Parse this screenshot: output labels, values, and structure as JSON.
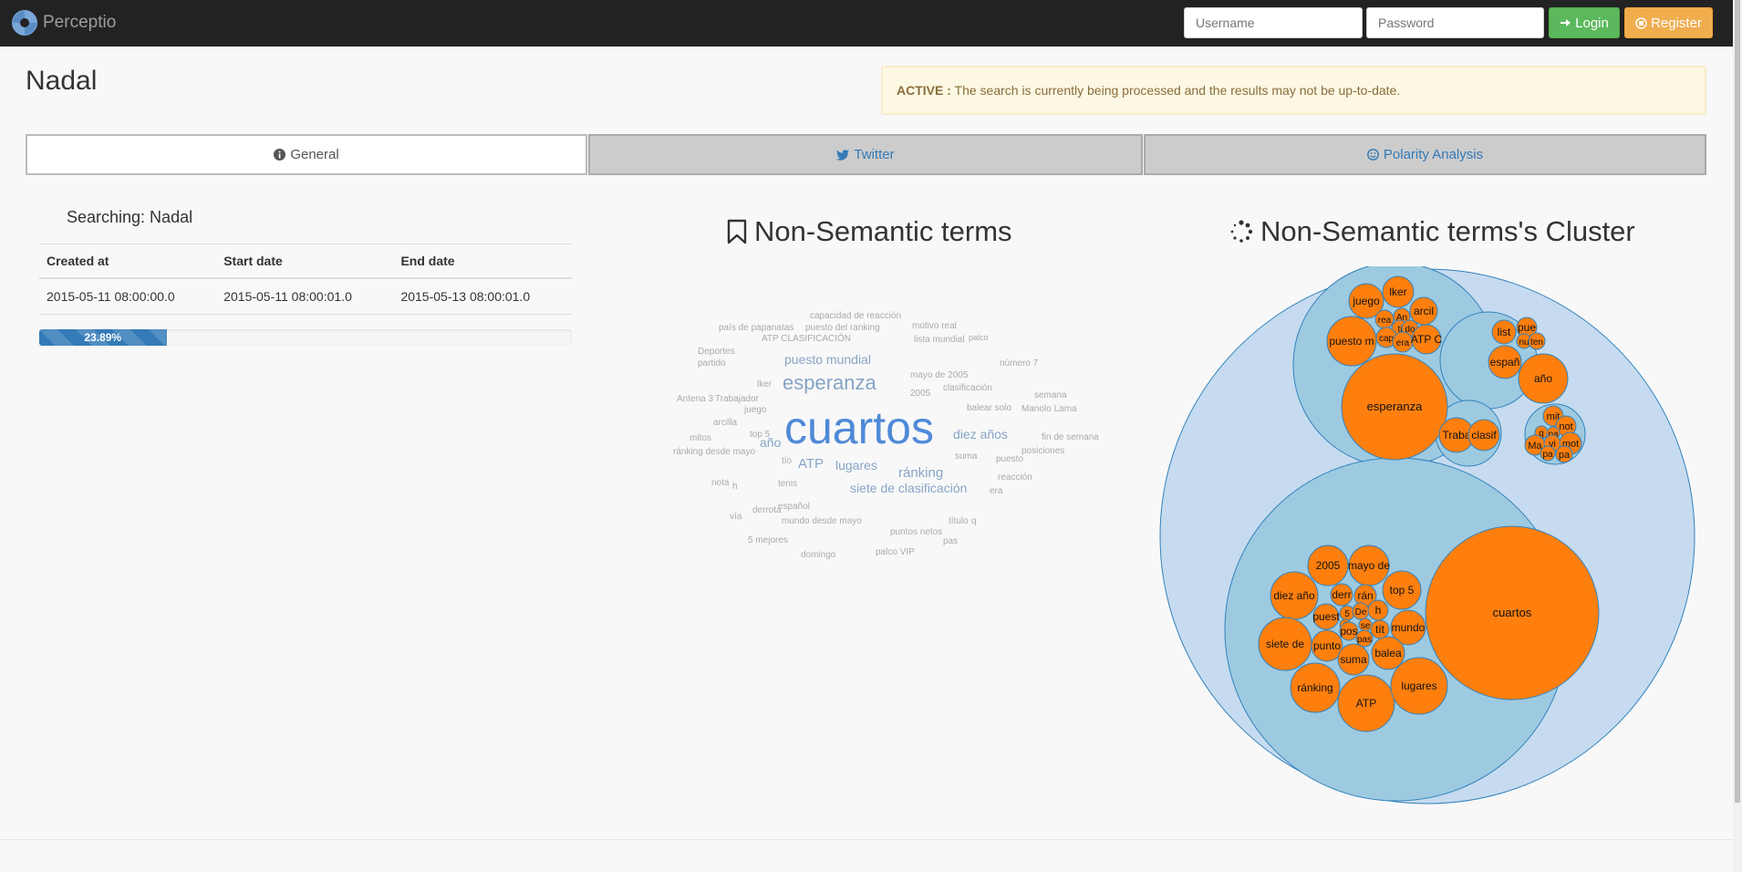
{
  "navbar": {
    "brand": "Perceptio",
    "username_placeholder": "Username",
    "password_placeholder": "Password",
    "login_label": "Login",
    "register_label": "Register"
  },
  "page": {
    "title": "Nadal",
    "alert_strong": "ACTIVE :",
    "alert_text": " The search is currently being processed and the results may not be up-to-date."
  },
  "tabs": [
    {
      "label": "General",
      "icon": "info-circle-icon"
    },
    {
      "label": "Twitter",
      "icon": "twitter-icon"
    },
    {
      "label": "Polarity Analysis",
      "icon": "smile-icon"
    }
  ],
  "general": {
    "searching": "Searching: Nadal",
    "headers": [
      "Created at",
      "Start date",
      "End date"
    ],
    "row": [
      "2015-05-11 08:00:00.0",
      "2015-05-11 08:00:01.0",
      "2015-05-13 08:00:01.0"
    ],
    "progress": 23.89,
    "progress_label": "23.89%"
  },
  "sections": {
    "wordcloud_title": "Non-Semantic terms",
    "cluster_title": "Non-Semantic terms's Cluster"
  },
  "colors": {
    "accent": "#337ab7",
    "bubble": "#ff7f0e",
    "cluster_outer": "#c6dbef",
    "cluster_inner": "#9ecae1"
  },
  "wordcloud": [
    {
      "text": "cuartos",
      "size": 50,
      "color": "#4f8ad8"
    },
    {
      "text": "esperanza",
      "size": 22,
      "color": "#86a4c6"
    },
    {
      "text": "puesto mundial",
      "size": 14,
      "color": "#86a4c6"
    },
    {
      "text": "diez años",
      "size": 14,
      "color": "#86a4c6"
    },
    {
      "text": "ránking",
      "size": 15,
      "color": "#86a4c6"
    },
    {
      "text": "siete de clasificación",
      "size": 14,
      "color": "#86a4c6"
    },
    {
      "text": "lugares",
      "size": 14,
      "color": "#86a4c6"
    },
    {
      "text": "ATP",
      "size": 15,
      "color": "#86a4c6"
    },
    {
      "text": "año",
      "size": 14,
      "color": "#86a4c6"
    },
    {
      "text": "capacidad de reacción",
      "size": 10,
      "color": "#aaaaaa"
    },
    {
      "text": "país de papanatas",
      "size": 10,
      "color": "#aaaaaa"
    },
    {
      "text": "puesto del ranking",
      "size": 10,
      "color": "#aaaaaa"
    },
    {
      "text": "motivo real",
      "size": 10,
      "color": "#aaaaaa"
    },
    {
      "text": "ATP CLASIFICACIÓN",
      "size": 10,
      "color": "#aaaaaa"
    },
    {
      "text": "lista mundial",
      "size": 10,
      "color": "#aaaaaa"
    },
    {
      "text": "palco",
      "size": 9,
      "color": "#aaaaaa"
    },
    {
      "text": "Deportes",
      "size": 10,
      "color": "#aaaaaa"
    },
    {
      "text": "partido",
      "size": 10,
      "color": "#aaaaaa"
    },
    {
      "text": "número 7",
      "size": 10,
      "color": "#aaaaaa"
    },
    {
      "text": "mayo de 2005",
      "size": 10,
      "color": "#aaaaaa"
    },
    {
      "text": "lker",
      "size": 10,
      "color": "#aaaaaa"
    },
    {
      "text": "2005",
      "size": 10,
      "color": "#aaaaaa"
    },
    {
      "text": "clasificación",
      "size": 10,
      "color": "#aaaaaa"
    },
    {
      "text": "semana",
      "size": 10,
      "color": "#aaaaaa"
    },
    {
      "text": "Antena 3",
      "size": 10,
      "color": "#aaaaaa"
    },
    {
      "text": "Trabajador",
      "size": 10,
      "color": "#aaaaaa"
    },
    {
      "text": "balear solo",
      "size": 10,
      "color": "#aaaaaa"
    },
    {
      "text": "Manolo Lama",
      "size": 10,
      "color": "#aaaaaa"
    },
    {
      "text": "juego",
      "size": 10,
      "color": "#aaaaaa"
    },
    {
      "text": "arcilla",
      "size": 10,
      "color": "#aaaaaa"
    },
    {
      "text": "mitos",
      "size": 10,
      "color": "#aaaaaa"
    },
    {
      "text": "top 5",
      "size": 10,
      "color": "#aaaaaa"
    },
    {
      "text": "fin de semana",
      "size": 10,
      "color": "#aaaaaa"
    },
    {
      "text": "posiciones",
      "size": 10,
      "color": "#aaaaaa"
    },
    {
      "text": "ránking desde mayo",
      "size": 10,
      "color": "#aaaaaa"
    },
    {
      "text": "suma",
      "size": 10,
      "color": "#aaaaaa"
    },
    {
      "text": "puesto",
      "size": 10,
      "color": "#aaaaaa"
    },
    {
      "text": "tío",
      "size": 10,
      "color": "#aaaaaa"
    },
    {
      "text": "reacción",
      "size": 10,
      "color": "#aaaaaa"
    },
    {
      "text": "nota",
      "size": 10,
      "color": "#aaaaaa"
    },
    {
      "text": "tenis",
      "size": 10,
      "color": "#aaaaaa"
    },
    {
      "text": "h",
      "size": 10,
      "color": "#aaaaaa"
    },
    {
      "text": "era",
      "size": 10,
      "color": "#aaaaaa"
    },
    {
      "text": "español",
      "size": 10,
      "color": "#aaaaaa"
    },
    {
      "text": "derrota",
      "size": 10,
      "color": "#aaaaaa"
    },
    {
      "text": "vía",
      "size": 10,
      "color": "#aaaaaa"
    },
    {
      "text": "mundo desde mayo",
      "size": 10,
      "color": "#aaaaaa"
    },
    {
      "text": "título",
      "size": 10,
      "color": "#aaaaaa"
    },
    {
      "text": "q",
      "size": 10,
      "color": "#aaaaaa"
    },
    {
      "text": "puntos netos",
      "size": 10,
      "color": "#aaaaaa"
    },
    {
      "text": "5 mejores",
      "size": 10,
      "color": "#aaaaaa"
    },
    {
      "text": "pas",
      "size": 10,
      "color": "#aaaaaa"
    },
    {
      "text": "domingo",
      "size": 10,
      "color": "#aaaaaa"
    },
    {
      "text": "palco VIP",
      "size": 10,
      "color": "#aaaaaa"
    }
  ],
  "cluster_labels": {
    "g1": [
      "juego",
      "lker",
      "arcil",
      "rea",
      "An",
      "ti",
      "do",
      "cap",
      "era",
      "ATP C",
      "puesto m",
      "esperanza"
    ],
    "g2": [
      "list",
      "pue",
      "nu",
      "ten",
      "españ",
      "año"
    ],
    "g3": [
      "Traba",
      "clasif"
    ],
    "g4": [
      "mit",
      "not",
      "q",
      "pa",
      "Ma",
      "vi",
      "pa",
      "mot",
      "pa"
    ],
    "g5": [
      "2005",
      "mayo de",
      "diez año",
      "derr",
      "rán",
      "top 5",
      "5",
      "De",
      "h",
      "puest",
      "f",
      "se",
      "pos",
      "tít",
      "mundo",
      "pas",
      "siete de",
      "punto",
      "suma",
      "balea",
      "ránking",
      "ATP",
      "lugares",
      "cuartos"
    ]
  }
}
